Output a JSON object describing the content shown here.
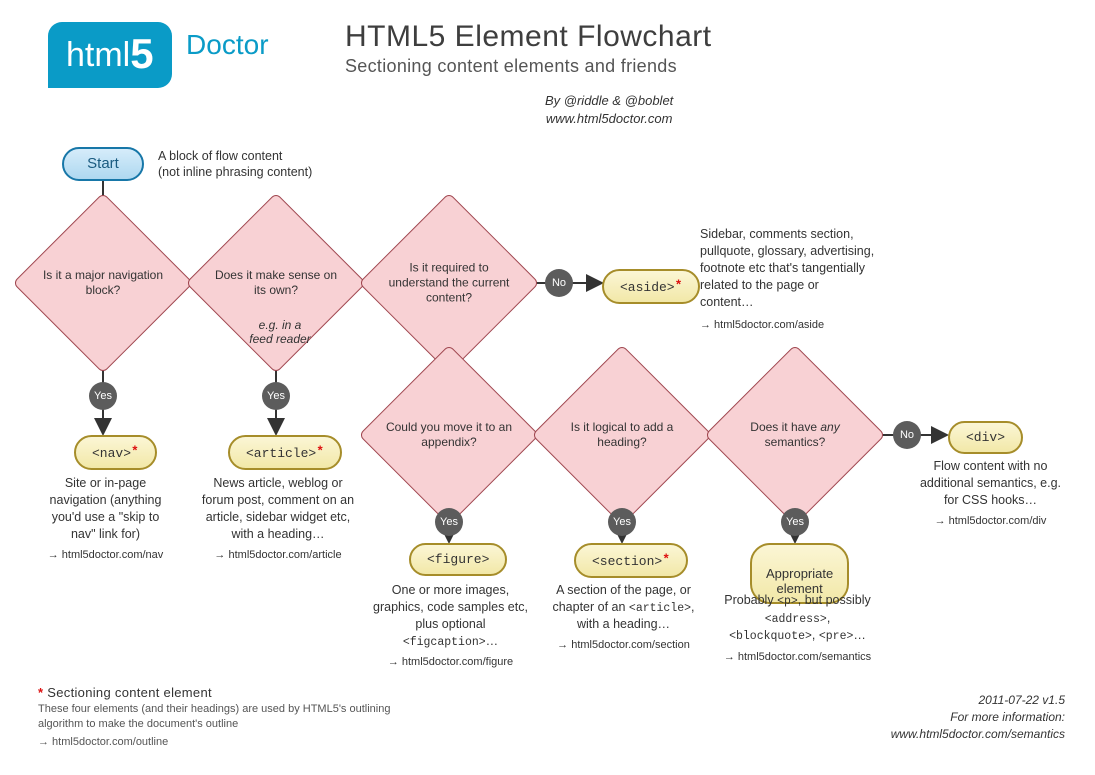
{
  "logo": {
    "html": "html",
    "five": "5",
    "doctor": "Doctor"
  },
  "title": "HTML5 Element Flowchart",
  "subtitle": "Sectioning content elements and friends",
  "byline_line1": "By @riddle & @boblet",
  "byline_line2": "www.html5doctor.com",
  "start": {
    "label": "Start",
    "note": "A block of flow content\n(not inline phrasing content)"
  },
  "decisions": {
    "d1": "Is it a major navigation block?",
    "d2": "Does it make sense on its own?",
    "d2_note": "e.g. in a\nfeed reader",
    "d3": "Is it required to understand the current content?",
    "d4": "Could you move it to an appendix?",
    "d5": "Is it logical to add a heading?",
    "d6": {
      "pre": "Does it have ",
      "em": "any",
      "post": " semantics?"
    }
  },
  "badges": {
    "yes": "Yes",
    "no": "No"
  },
  "terminals": {
    "nav": "<nav>",
    "article": "<article>",
    "aside": "<aside>",
    "figure": "<figure>",
    "section": "<section>",
    "appropriate": "Appropriate\nelement",
    "div": "<div>"
  },
  "descs": {
    "nav": {
      "text": "Site or in-page navigation (anything you'd use a \"skip to nav\" link for)",
      "link": "→ html5doctor.com/nav"
    },
    "article": {
      "text": "News article, weblog or forum post, comment on an article, sidebar widget etc, with a heading…",
      "link": "→ html5doctor.com/article"
    },
    "aside": {
      "text": "Sidebar, comments section, pullquote, glossary, advertising, footnote etc that's tangentially related to the page or content…",
      "link": "→ html5doctor.com/aside"
    },
    "figure": {
      "text_pre": "One or more images, graphics, code samples etc, plus optional ",
      "mono": "<figcaption>",
      "text_post": "…",
      "link": "→ html5doctor.com/figure"
    },
    "section": {
      "text_pre": "A section of the page, or chapter of an ",
      "mono": "<article>",
      "text_post": ", with a heading…",
      "link": "→ html5doctor.com/section"
    },
    "appropriate": {
      "text_pre": "Probably ",
      "mono1": "<p>",
      "text_mid": ", but possibly ",
      "mono2": "<address>",
      "mono3": "<blockquote>",
      "mono4": "<pre>",
      "text_post": "…",
      "link": "→ html5doctor.com/semantics"
    },
    "div": {
      "text": "Flow content with no additional semantics, e.g. for CSS hooks…",
      "link": "→ html5doctor.com/div"
    }
  },
  "legend": {
    "title": "Sectioning content element",
    "body": "These four elements (and their headings) are used by HTML5's outlining algorithm to make the document's outline",
    "link": "→ html5doctor.com/outline"
  },
  "footer": {
    "date": "2011-07-22 v1.5",
    "more": "For more information:",
    "url": "www.html5doctor.com/semantics"
  }
}
